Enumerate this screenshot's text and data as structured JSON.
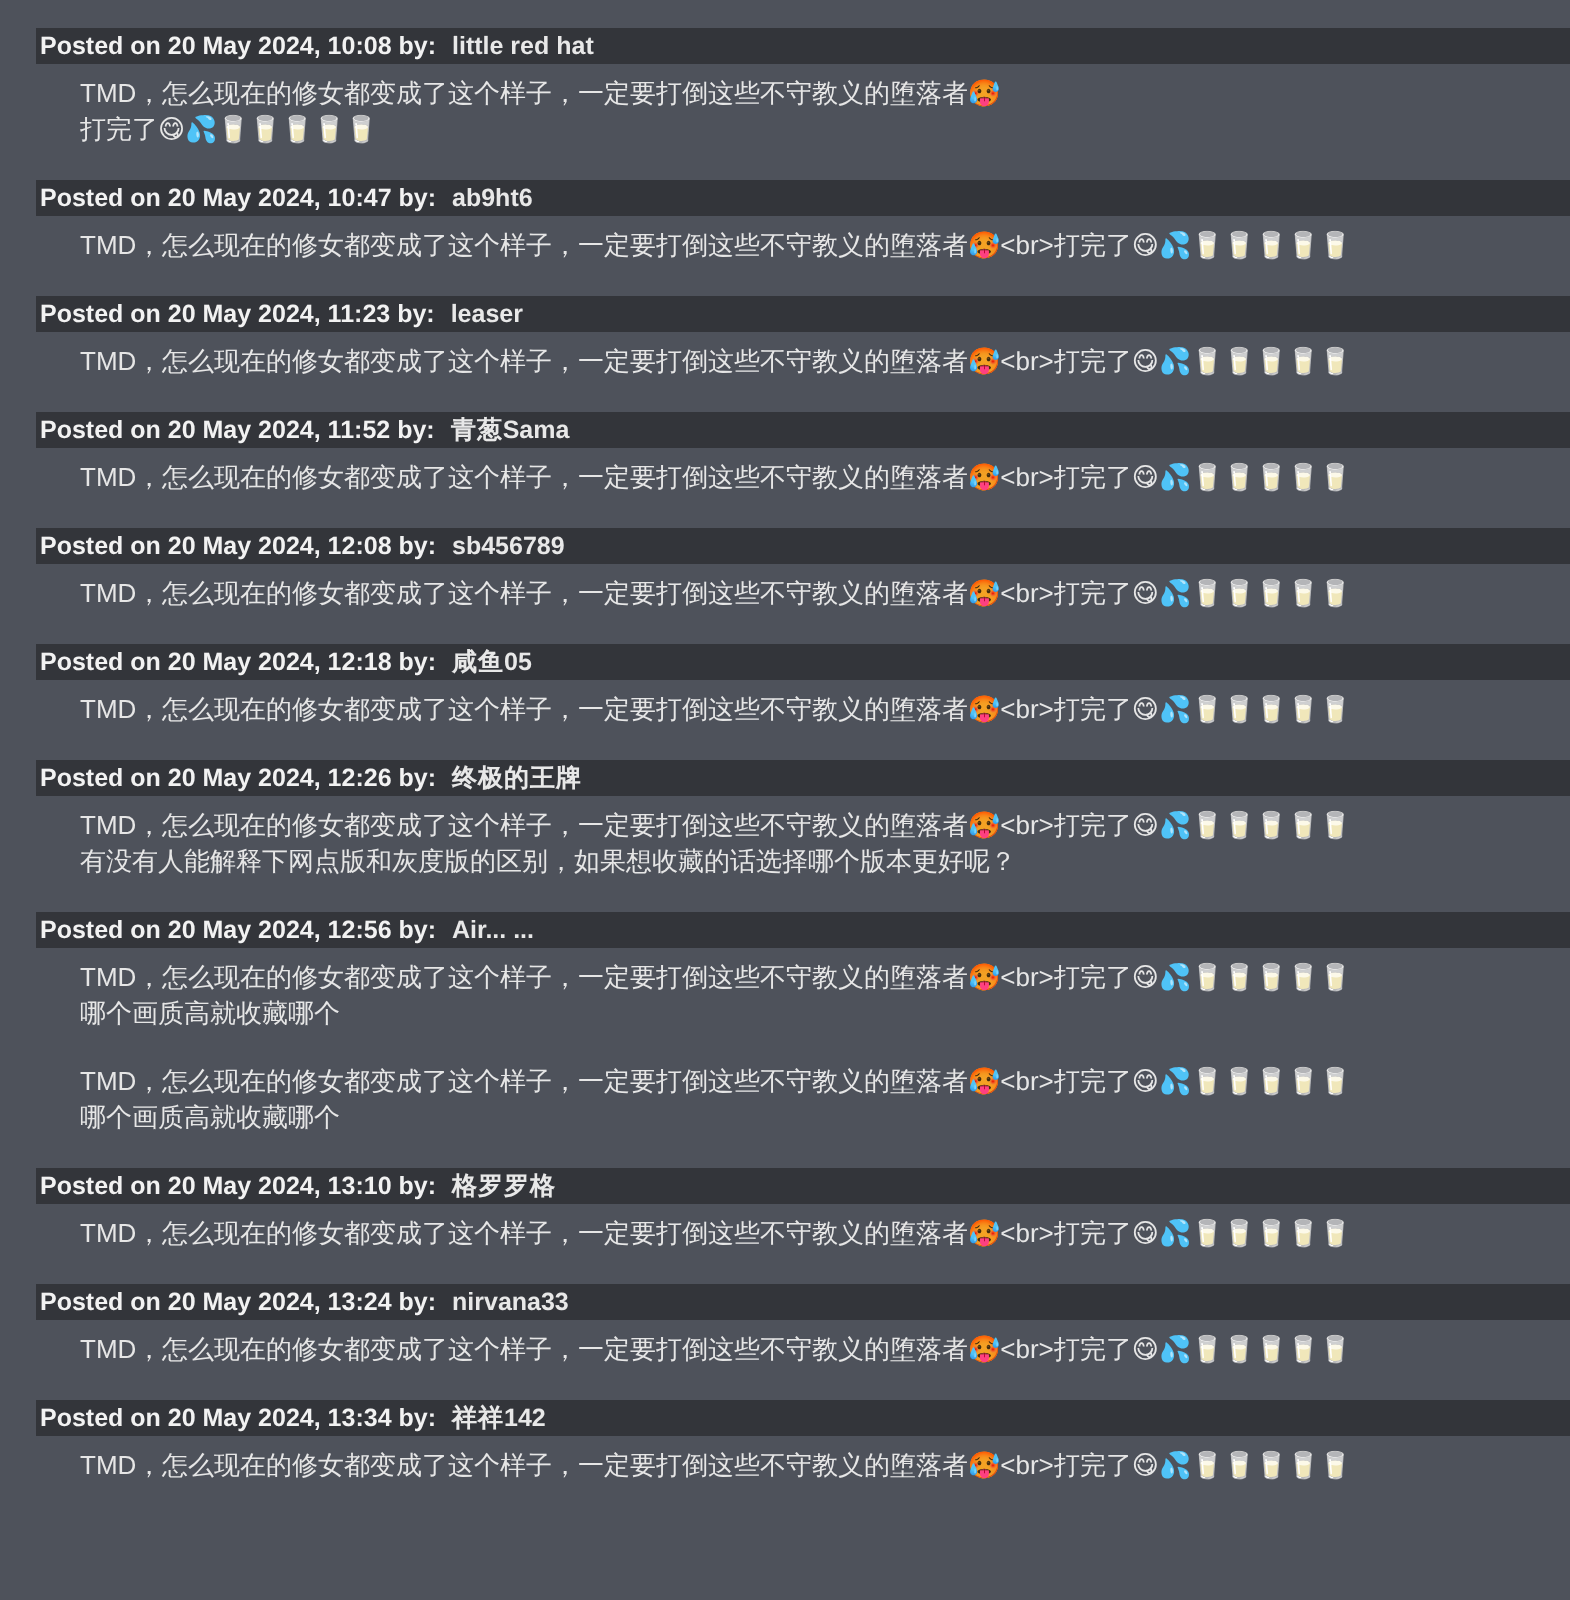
{
  "posts": [
    {
      "posted": "Posted on 20 May 2024, 10:08 by:",
      "author": "little red hat",
      "paragraphs": [
        [
          "TMD，怎么现在的修女都变成了这个样子，一定要打倒这些不守教义的堕落者🥵",
          "打完了😋💦🥛🥛🥛🥛🥛"
        ]
      ]
    },
    {
      "posted": "Posted on 20 May 2024, 10:47 by:",
      "author": "ab9ht6",
      "paragraphs": [
        [
          "TMD，怎么现在的修女都变成了这个样子，一定要打倒这些不守教义的堕落者🥵<br>打完了😋💦🥛🥛🥛🥛🥛"
        ]
      ]
    },
    {
      "posted": "Posted on 20 May 2024, 11:23 by:",
      "author": "leaser",
      "paragraphs": [
        [
          "TMD，怎么现在的修女都变成了这个样子，一定要打倒这些不守教义的堕落者🥵<br>打完了😋💦🥛🥛🥛🥛🥛"
        ]
      ]
    },
    {
      "posted": "Posted on 20 May 2024, 11:52 by:",
      "author": "青葱Sama",
      "paragraphs": [
        [
          "TMD，怎么现在的修女都变成了这个样子，一定要打倒这些不守教义的堕落者🥵<br>打完了😋💦🥛🥛🥛🥛🥛"
        ]
      ]
    },
    {
      "posted": "Posted on 20 May 2024, 12:08 by:",
      "author": "sb456789",
      "paragraphs": [
        [
          "TMD，怎么现在的修女都变成了这个样子，一定要打倒这些不守教义的堕落者🥵<br>打完了😋💦🥛🥛🥛🥛🥛"
        ]
      ]
    },
    {
      "posted": "Posted on 20 May 2024, 12:18 by:",
      "author": "咸鱼05",
      "paragraphs": [
        [
          "TMD，怎么现在的修女都变成了这个样子，一定要打倒这些不守教义的堕落者🥵<br>打完了😋💦🥛🥛🥛🥛🥛"
        ]
      ]
    },
    {
      "posted": "Posted on 20 May 2024, 12:26 by:",
      "author": "终极的王牌",
      "paragraphs": [
        [
          "TMD，怎么现在的修女都变成了这个样子，一定要打倒这些不守教义的堕落者🥵<br>打完了😋💦🥛🥛🥛🥛🥛",
          "有没有人能解释下网点版和灰度版的区别，如果想收藏的话选择哪个版本更好呢？"
        ]
      ]
    },
    {
      "posted": "Posted on 20 May 2024, 12:56 by:",
      "author": "Air... ...",
      "paragraphs": [
        [
          "TMD，怎么现在的修女都变成了这个样子，一定要打倒这些不守教义的堕落者🥵<br>打完了😋💦🥛🥛🥛🥛🥛",
          "哪个画质高就收藏哪个"
        ],
        [
          "TMD，怎么现在的修女都变成了这个样子，一定要打倒这些不守教义的堕落者🥵<br>打完了😋💦🥛🥛🥛🥛🥛",
          "哪个画质高就收藏哪个"
        ]
      ]
    },
    {
      "posted": "Posted on 20 May 2024, 13:10 by:",
      "author": "格罗罗格",
      "paragraphs": [
        [
          "TMD，怎么现在的修女都变成了这个样子，一定要打倒这些不守教义的堕落者🥵<br>打完了😋💦🥛🥛🥛🥛🥛"
        ]
      ]
    },
    {
      "posted": "Posted on 20 May 2024, 13:24 by:",
      "author": "nirvana33",
      "paragraphs": [
        [
          "TMD，怎么现在的修女都变成了这个样子，一定要打倒这些不守教义的堕落者🥵<br>打完了😋💦🥛🥛🥛🥛🥛"
        ]
      ]
    },
    {
      "posted": "Posted on 20 May 2024, 13:34 by:",
      "author": "祥祥142",
      "paragraphs": [
        [
          "TMD，怎么现在的修女都变成了这个样子，一定要打倒这些不守教义的堕落者🥵<br>打完了😋💦🥛🥛🥛🥛🥛"
        ]
      ]
    }
  ]
}
